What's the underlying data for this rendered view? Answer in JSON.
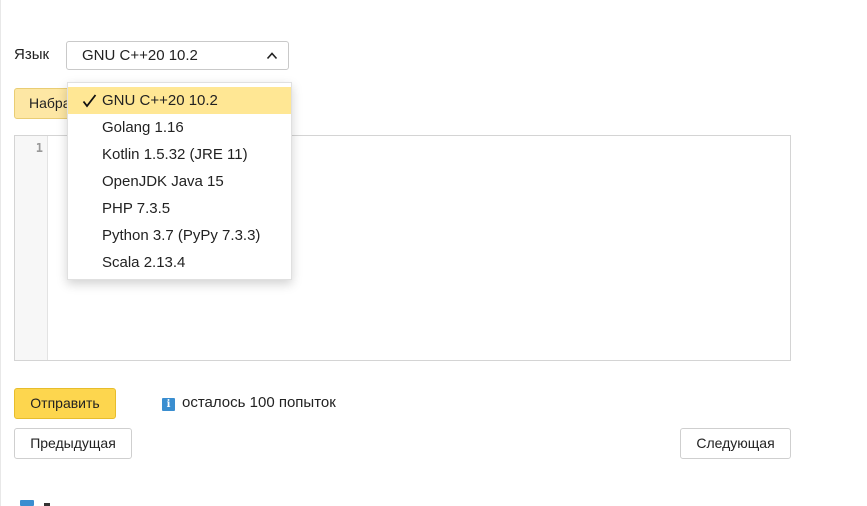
{
  "language": {
    "label": "Язык",
    "selected": "GNU C++20 10.2",
    "options": [
      "GNU C++20 10.2",
      "Golang 1.16",
      "Kotlin 1.5.32 (JRE 11)",
      "OpenJDK Java 15",
      "PHP 7.3.5",
      "Python 3.7 (PyPy 7.3.3)",
      "Scala 2.13.4"
    ]
  },
  "typed_button": {
    "label": "Набрать здесь"
  },
  "editor": {
    "line_number": "1",
    "content": ""
  },
  "actions": {
    "send_label": "Отправить",
    "attempts_text": "осталось 100 попыток",
    "prev_label": "Предыдущая",
    "next_label": "Следующая"
  },
  "colors": {
    "accent_yellow": "#fdd64e",
    "selected_option_bg": "#ffe794",
    "info_blue": "#3a8ed0"
  }
}
